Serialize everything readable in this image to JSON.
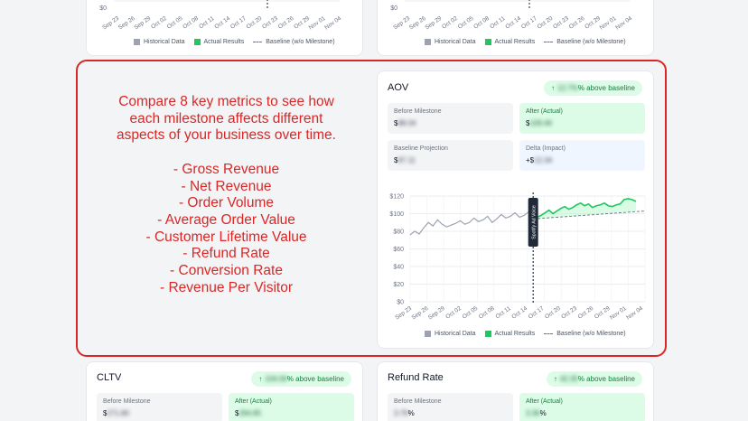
{
  "top_legend": {
    "historical": "Historical Data",
    "actual": "Actual Results",
    "baseline": "Baseline (w/o Milestone)"
  },
  "top_x_ticks": [
    "Sep 23",
    "Sep 26",
    "Sep 29",
    "Oct 02",
    "Oct 05",
    "Oct 08",
    "Oct 11",
    "Oct 14",
    "Oct 17",
    "Oct 20",
    "Oct 23",
    "Oct 26",
    "Oct 29",
    "Nov 01",
    "Nov 04"
  ],
  "top_y_tick": "$0",
  "overlay": {
    "intro": "Compare 8 key metrics to see how each milestone affects different aspects of your business over time.",
    "metrics": [
      "- Gross Revenue",
      "- Net Revenue",
      "- Order Volume",
      "- Average Order Value",
      "- Customer Lifetime Value",
      "- Refund Rate",
      "- Conversion Rate",
      "- Revenue Per Visitor"
    ]
  },
  "aov_card": {
    "title": "AOV",
    "badge_arrow": "↑",
    "badge_value": "12.7%",
    "badge_suffix": "% above baseline",
    "before_label": "Before Milestone",
    "before_prefix": "$",
    "before_value": "88.04",
    "after_label": "After (Actual)",
    "after_prefix": "$",
    "after_value": "109.46",
    "baseline_label": "Baseline Projection",
    "baseline_prefix": "$",
    "baseline_value": "97.11",
    "delta_label": "Delta (Impact)",
    "delta_prefix": "+$",
    "delta_value": "12.34",
    "milestone_label": "Spotify Ad Voice",
    "legend_historical": "Historical Data",
    "legend_actual": "Actual Results",
    "legend_baseline": "Baseline (w/o Milestone)"
  },
  "cltv_card": {
    "title": "CLTV",
    "badge_arrow": "↑",
    "badge_value": "104.06",
    "badge_suffix": "% above baseline",
    "before_label": "Before Milestone",
    "before_prefix": "$",
    "before_value": "271.80",
    "after_label": "After (Actual)",
    "after_prefix": "$",
    "after_value": "294.85"
  },
  "refund_card": {
    "title": "Refund Rate",
    "badge_arrow": "↑",
    "badge_value": "42.35",
    "badge_suffix": "% above baseline",
    "before_label": "Before Milestone",
    "before_value": "3.79",
    "before_suffix": "%",
    "after_label": "After (Actual)",
    "after_value": "3.36",
    "after_suffix": "%"
  },
  "chart_data": {
    "type": "line",
    "title": "",
    "x": [
      "Sep 23",
      "Sep 26",
      "Sep 29",
      "Oct 02",
      "Oct 05",
      "Oct 08",
      "Oct 11",
      "Oct 14",
      "Oct 17",
      "Oct 20",
      "Oct 23",
      "Oct 26",
      "Oct 29",
      "Nov 01",
      "Nov 04"
    ],
    "y_ticks": [
      "$0",
      "$20",
      "$40",
      "$60",
      "$80",
      "$100",
      "$120"
    ],
    "ylim": [
      0,
      120
    ],
    "milestone_x": "Oct 15",
    "series": [
      {
        "name": "Historical Data",
        "values": [
          76,
          80,
          77,
          84,
          90,
          86,
          93,
          88,
          85,
          87,
          89,
          92,
          88,
          90,
          95,
          91,
          93,
          97,
          90,
          94,
          99,
          95,
          97,
          101,
          96,
          98,
          102,
          99
        ]
      },
      {
        "name": "Actual Results",
        "values": [
          99,
          96,
          98,
          101,
          104,
          100,
          103,
          106,
          108,
          105,
          107,
          110,
          112,
          109,
          111,
          107,
          109,
          110,
          112,
          109,
          108,
          110,
          111,
          116,
          117,
          116,
          114
        ]
      },
      {
        "name": "Baseline (w/o Milestone)",
        "values": [
          94,
          103
        ]
      }
    ],
    "legend": "bottom",
    "grid": true
  }
}
